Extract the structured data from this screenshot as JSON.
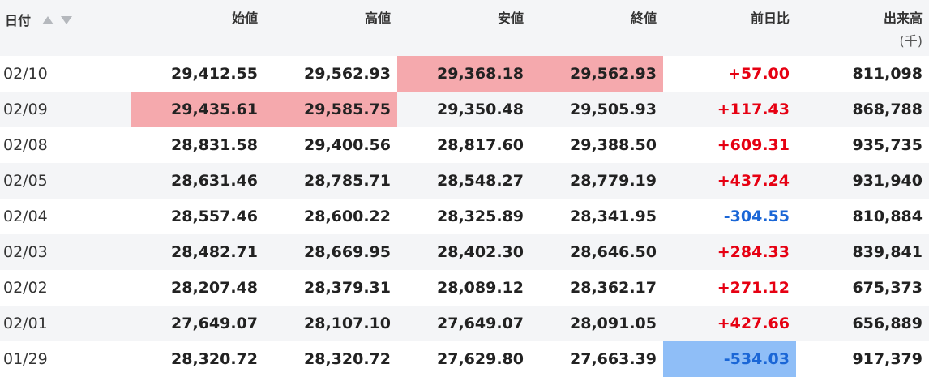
{
  "colors": {
    "positive": "#e60012",
    "negative": "#1a66d6",
    "highlight_red": "#f5a9ad",
    "highlight_blue": "#8fbef7"
  },
  "header": {
    "date": "日付",
    "open": "始値",
    "high": "高値",
    "low": "安値",
    "close": "終値",
    "change": "前日比",
    "volume": "出来高",
    "volume_unit": "(千)"
  },
  "rows": [
    {
      "date": "02/10",
      "open": "29,412.55",
      "high": "29,562.93",
      "low": "29,368.18",
      "close": "29,562.93",
      "change": "+57.00",
      "volume": "811,098"
    },
    {
      "date": "02/09",
      "open": "29,435.61",
      "high": "29,585.75",
      "low": "29,350.48",
      "close": "29,505.93",
      "change": "+117.43",
      "volume": "868,788"
    },
    {
      "date": "02/08",
      "open": "28,831.58",
      "high": "29,400.56",
      "low": "28,817.60",
      "close": "29,388.50",
      "change": "+609.31",
      "volume": "935,735"
    },
    {
      "date": "02/05",
      "open": "28,631.46",
      "high": "28,785.71",
      "low": "28,548.27",
      "close": "28,779.19",
      "change": "+437.24",
      "volume": "931,940"
    },
    {
      "date": "02/04",
      "open": "28,557.46",
      "high": "28,600.22",
      "low": "28,325.89",
      "close": "28,341.95",
      "change": "-304.55",
      "volume": "810,884"
    },
    {
      "date": "02/03",
      "open": "28,482.71",
      "high": "28,669.95",
      "low": "28,402.30",
      "close": "28,646.50",
      "change": "+284.33",
      "volume": "839,841"
    },
    {
      "date": "02/02",
      "open": "28,207.48",
      "high": "28,379.31",
      "low": "28,089.12",
      "close": "28,362.17",
      "change": "+271.12",
      "volume": "675,373"
    },
    {
      "date": "02/01",
      "open": "27,649.07",
      "high": "28,107.10",
      "low": "27,649.07",
      "close": "28,091.05",
      "change": "+427.66",
      "volume": "656,889"
    },
    {
      "date": "01/29",
      "open": "28,320.72",
      "high": "28,320.72",
      "low": "27,629.80",
      "close": "27,663.39",
      "change": "-534.03",
      "volume": "917,379"
    }
  ]
}
